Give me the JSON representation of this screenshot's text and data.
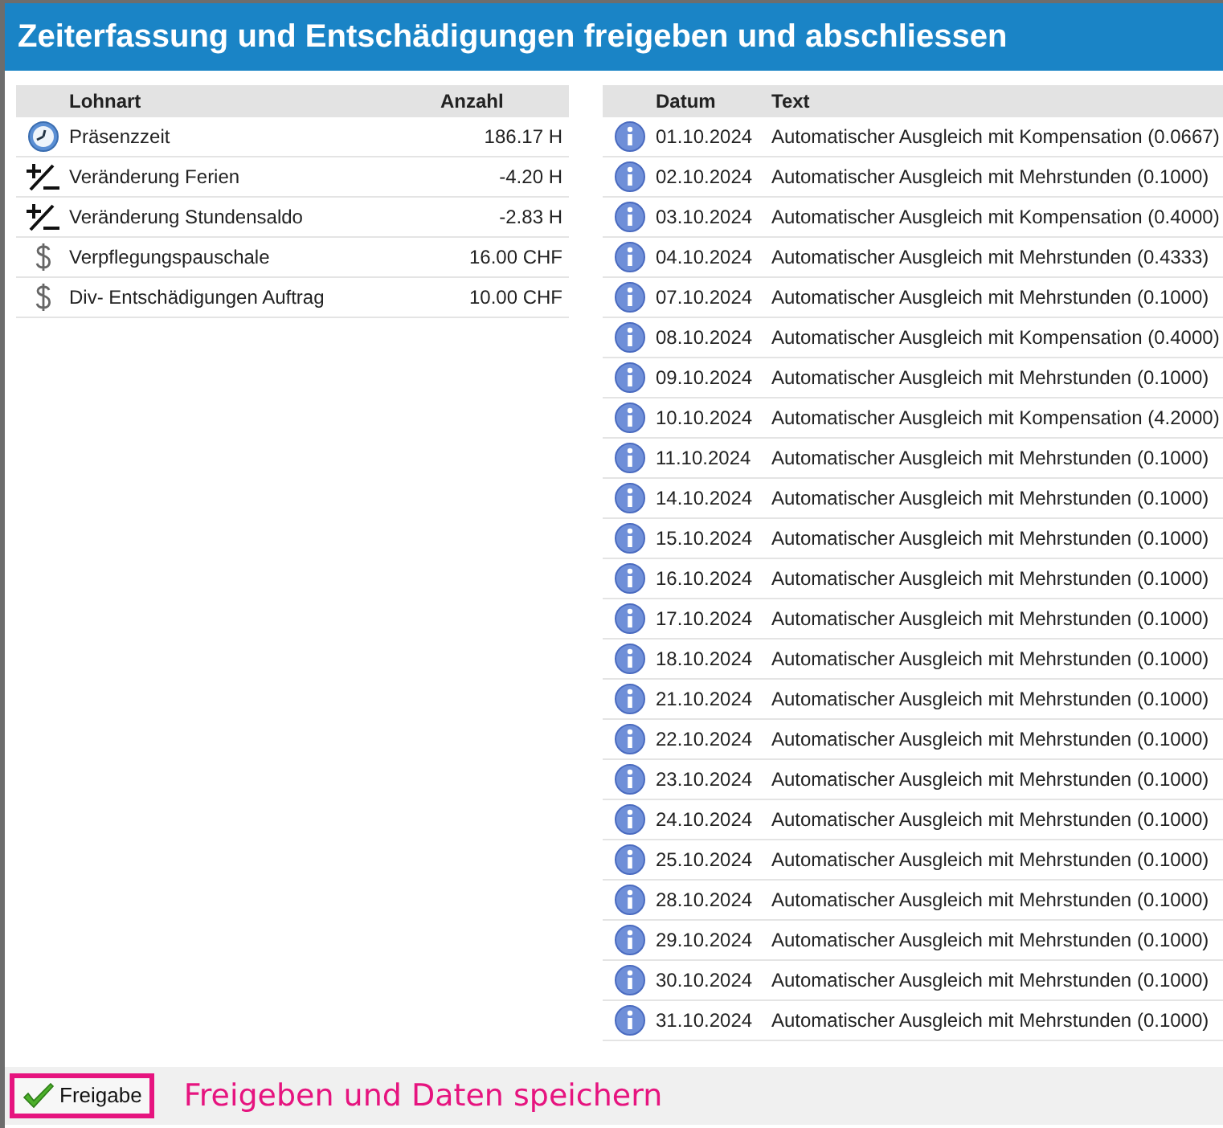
{
  "window": {
    "title": "Zeiterfassung und Entschädigungen freigeben und abschliessen"
  },
  "lohnarten": {
    "columns": [
      "Lohnart",
      "Anzahl"
    ],
    "rows": [
      {
        "kind": "clock",
        "name": "Präsenzzeit",
        "amount": "186.17 H"
      },
      {
        "kind": "plusminus",
        "name": "Veränderung Ferien",
        "amount": "-4.20 H"
      },
      {
        "kind": "plusminus",
        "name": "Veränderung Stundensaldo",
        "amount": "-2.83 H"
      },
      {
        "kind": "dollar",
        "name": "Verpflegungspauschale",
        "amount": "16.00 CHF"
      },
      {
        "kind": "dollar",
        "name": "Div- Entschädigungen Auftrag",
        "amount": "10.00 CHF"
      }
    ]
  },
  "messages": {
    "columns": [
      "Datum",
      "Text"
    ],
    "rows": [
      {
        "date": "01.10.2024",
        "text": "Automatischer Ausgleich mit Kompensation (0.0667)"
      },
      {
        "date": "02.10.2024",
        "text": "Automatischer Ausgleich mit Mehrstunden (0.1000)"
      },
      {
        "date": "03.10.2024",
        "text": "Automatischer Ausgleich mit Kompensation (0.4000)"
      },
      {
        "date": "04.10.2024",
        "text": "Automatischer Ausgleich mit Mehrstunden (0.4333)"
      },
      {
        "date": "07.10.2024",
        "text": "Automatischer Ausgleich mit Mehrstunden (0.1000)"
      },
      {
        "date": "08.10.2024",
        "text": "Automatischer Ausgleich mit Kompensation (0.4000)"
      },
      {
        "date": "09.10.2024",
        "text": "Automatischer Ausgleich mit Mehrstunden (0.1000)"
      },
      {
        "date": "10.10.2024",
        "text": "Automatischer Ausgleich mit Kompensation (4.2000)"
      },
      {
        "date": "11.10.2024",
        "text": "Automatischer Ausgleich mit Mehrstunden (0.1000)"
      },
      {
        "date": "14.10.2024",
        "text": "Automatischer Ausgleich mit Mehrstunden (0.1000)"
      },
      {
        "date": "15.10.2024",
        "text": "Automatischer Ausgleich mit Mehrstunden (0.1000)"
      },
      {
        "date": "16.10.2024",
        "text": "Automatischer Ausgleich mit Mehrstunden (0.1000)"
      },
      {
        "date": "17.10.2024",
        "text": "Automatischer Ausgleich mit Mehrstunden (0.1000)"
      },
      {
        "date": "18.10.2024",
        "text": "Automatischer Ausgleich mit Mehrstunden (0.1000)"
      },
      {
        "date": "21.10.2024",
        "text": "Automatischer Ausgleich mit Mehrstunden (0.1000)"
      },
      {
        "date": "22.10.2024",
        "text": "Automatischer Ausgleich mit Mehrstunden (0.1000)"
      },
      {
        "date": "23.10.2024",
        "text": "Automatischer Ausgleich mit Mehrstunden (0.1000)"
      },
      {
        "date": "24.10.2024",
        "text": "Automatischer Ausgleich mit Mehrstunden (0.1000)"
      },
      {
        "date": "25.10.2024",
        "text": "Automatischer Ausgleich mit Mehrstunden (0.1000)"
      },
      {
        "date": "28.10.2024",
        "text": "Automatischer Ausgleich mit Mehrstunden (0.1000)"
      },
      {
        "date": "29.10.2024",
        "text": "Automatischer Ausgleich mit Mehrstunden (0.1000)"
      },
      {
        "date": "30.10.2024",
        "text": "Automatischer Ausgleich mit Mehrstunden (0.1000)"
      },
      {
        "date": "31.10.2024",
        "text": "Automatischer Ausgleich mit Mehrstunden (0.1000)"
      }
    ]
  },
  "footer": {
    "button": "Freigabe",
    "annotation": "Freigeben und Daten speichern"
  }
}
